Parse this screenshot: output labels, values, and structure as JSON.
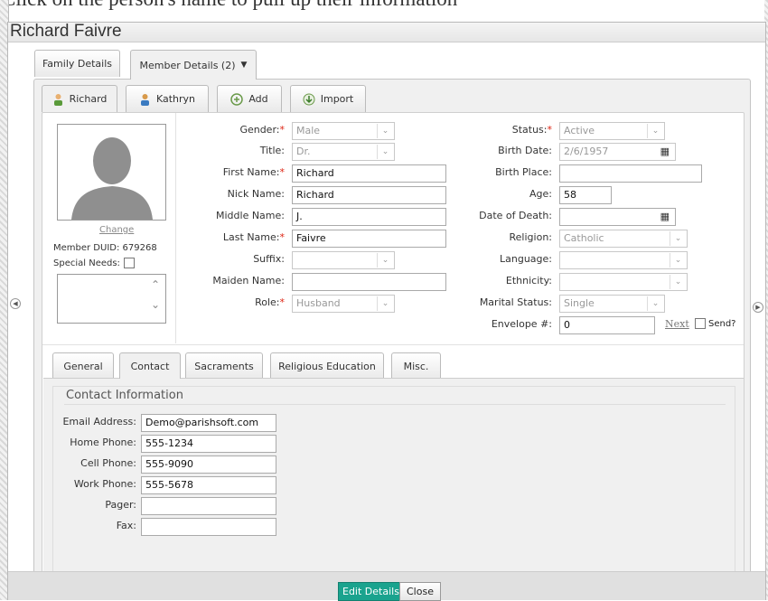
{
  "clipped_header": "Click on the person's name to pull up their information",
  "window": {
    "title": "Richard Faivre"
  },
  "top_tabs": [
    {
      "label": "Family Details"
    },
    {
      "label": "Member Details (2)",
      "icon": "triangle-down-icon"
    }
  ],
  "member_tabs": [
    {
      "label": "Richard",
      "icon": "person-male-icon"
    },
    {
      "label": "Kathryn",
      "icon": "person-female-icon"
    },
    {
      "label": "Add",
      "icon": "add-person-icon"
    },
    {
      "label": "Import",
      "icon": "import-icon"
    }
  ],
  "profile": {
    "change_link": "Change",
    "member_duid_label": "Member DUID: 679268",
    "special_needs_label": "Special Needs:"
  },
  "left_form": {
    "gender": {
      "label": "Gender:",
      "value": "Male"
    },
    "title": {
      "label": "Title:",
      "value": "Dr."
    },
    "first_name": {
      "label": "First Name:",
      "value": "Richard"
    },
    "nick_name": {
      "label": "Nick Name:",
      "value": "Richard"
    },
    "middle_name": {
      "label": "Middle Name:",
      "value": "J."
    },
    "last_name": {
      "label": "Last Name:",
      "value": "Faivre"
    },
    "suffix": {
      "label": "Suffix:",
      "value": ""
    },
    "maiden_name": {
      "label": "Maiden Name:",
      "value": ""
    },
    "role": {
      "label": "Role:",
      "value": "Husband"
    }
  },
  "right_form": {
    "status": {
      "label": "Status:",
      "value": "Active"
    },
    "birth_date": {
      "label": "Birth Date:",
      "value": "2/6/1957"
    },
    "birth_place": {
      "label": "Birth Place:",
      "value": ""
    },
    "age": {
      "label": "Age:",
      "value": "58"
    },
    "date_of_death": {
      "label": "Date of Death:",
      "value": ""
    },
    "religion": {
      "label": "Religion:",
      "value": "Catholic"
    },
    "language": {
      "label": "Language:",
      "value": ""
    },
    "ethnicity": {
      "label": "Ethnicity:",
      "value": ""
    },
    "marital_status": {
      "label": "Marital Status:",
      "value": "Single"
    },
    "envelope": {
      "label": "Envelope #:",
      "value": "0",
      "next_link": "Next",
      "send_label": "Send?"
    }
  },
  "section_tabs": [
    {
      "label": "General"
    },
    {
      "label": "Contact"
    },
    {
      "label": "Sacraments"
    },
    {
      "label": "Religious Education"
    },
    {
      "label": "Misc."
    }
  ],
  "contact": {
    "title": "Contact Information",
    "email": {
      "label": "Email Address:",
      "value": "Demo@parishsoft.com"
    },
    "home_phone": {
      "label": "Home Phone:",
      "value": "555-1234"
    },
    "cell_phone": {
      "label": "Cell Phone:",
      "value": "555-9090"
    },
    "work_phone": {
      "label": "Work Phone:",
      "value": "555-5678"
    },
    "pager": {
      "label": "Pager:",
      "value": ""
    },
    "fax": {
      "label": "Fax:",
      "value": ""
    }
  },
  "footer": {
    "edit_label": "Edit Details",
    "close_label": "Close"
  },
  "colors": {
    "accent": "#1aa38e",
    "required": "#dd2211"
  }
}
